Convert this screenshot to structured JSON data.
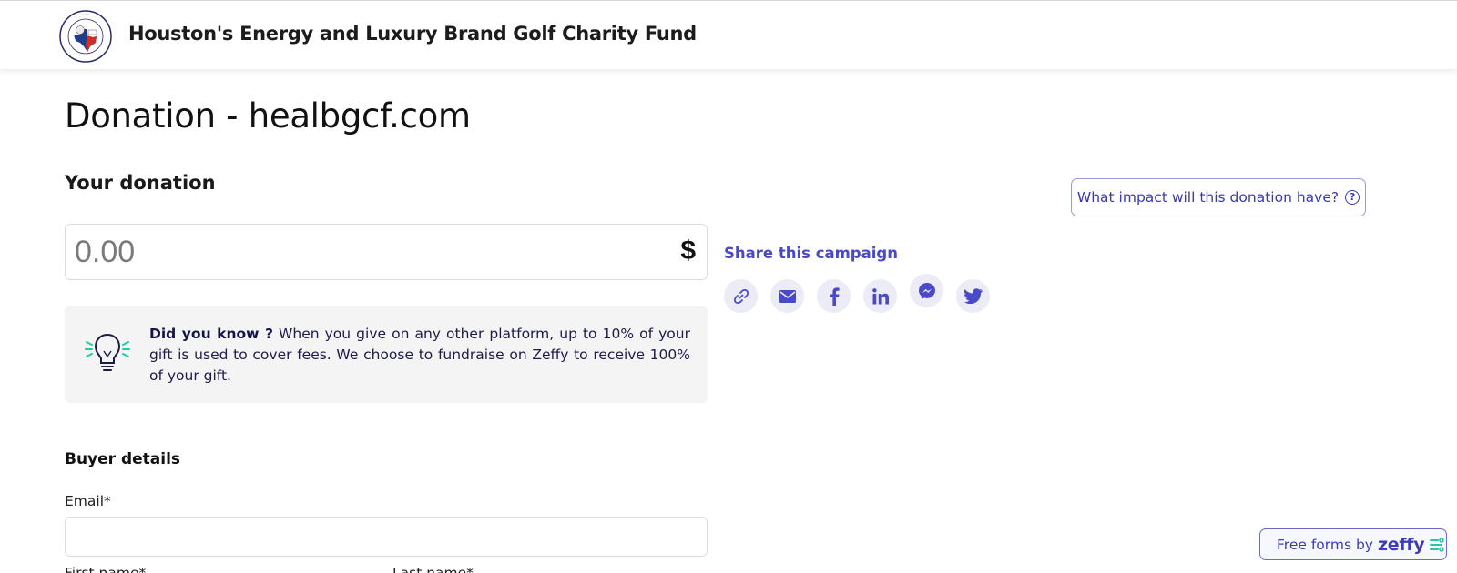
{
  "header": {
    "org_name": "Houston's Energy and Luxury Brand Golf Charity Fund",
    "logo_icon": "golf-tournament-logo"
  },
  "page": {
    "title": "Donation - healbgcf.com"
  },
  "donation": {
    "section_title": "Your donation",
    "amount_placeholder": "0.00",
    "currency_symbol": "$"
  },
  "info": {
    "icon": "lightbulb-icon",
    "bold_lead": "Did you know ?",
    "text": " When you give on any other platform, up to 10% of your gift is used to cover fees. We choose to fundraise on Zeffy to receive 100% of your gift."
  },
  "buyer": {
    "section_title": "Buyer details",
    "email_label": "Email*",
    "email_value": "",
    "first_name_label": "First name*",
    "last_name_label": "Last name*"
  },
  "impact": {
    "button_label": "What impact will this donation have?",
    "icon": "question-circle-icon"
  },
  "share": {
    "title": "Share this campaign",
    "buttons": [
      {
        "icon": "link-icon"
      },
      {
        "icon": "mail-icon"
      },
      {
        "icon": "facebook-icon"
      },
      {
        "icon": "linkedin-icon"
      },
      {
        "icon": "messenger-icon"
      },
      {
        "icon": "twitter-icon"
      }
    ]
  },
  "footer_badge": {
    "prefix": "Free forms by",
    "brand": "zeffy"
  },
  "colors": {
    "accent": "#4b4ac6",
    "info_bg": "#f4f4f5",
    "share_bg": "#ececf6"
  }
}
